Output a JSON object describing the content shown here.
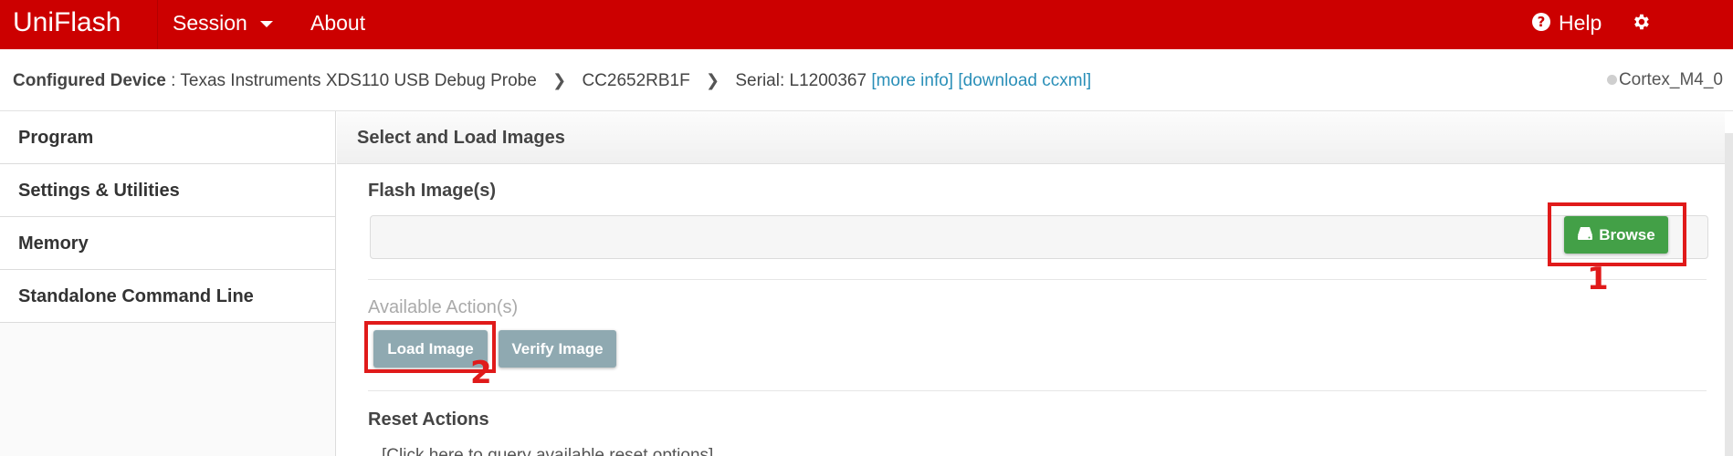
{
  "app": {
    "brand": "UniFlash"
  },
  "nav": {
    "session": "Session",
    "about": "About",
    "help": "Help",
    "settings": "Settings"
  },
  "device": {
    "label": "Configured Device",
    "separator": " : ",
    "probe": "Texas Instruments XDS110 USB Debug Probe",
    "chip": "CC2652RB1F",
    "serial": "Serial: L1200367",
    "more_info": "[more info]",
    "download": "[download ccxml]",
    "core": "Cortex_M4_0"
  },
  "sidebar": {
    "items": [
      {
        "label": "Program"
      },
      {
        "label": "Settings & Utilities"
      },
      {
        "label": "Memory"
      },
      {
        "label": "Standalone Command Line"
      }
    ]
  },
  "main": {
    "panel_title": "Select and Load Images",
    "flash_title": "Flash Image(s)",
    "file_value": "",
    "browse_label": "Browse",
    "available_title": "Available Action(s)",
    "load_label": "Load Image",
    "verify_label": "Verify Image",
    "reset_title": "Reset Actions",
    "reset_link": "[Click here to query available reset options]"
  },
  "annotations": {
    "one": "1",
    "two": "2",
    "color": "#e01a1a"
  },
  "colors": {
    "brand_red": "#cc0000",
    "browse_green": "#43a047",
    "action_gray": "#8fa9b1",
    "link_blue": "#2a8fb8"
  }
}
